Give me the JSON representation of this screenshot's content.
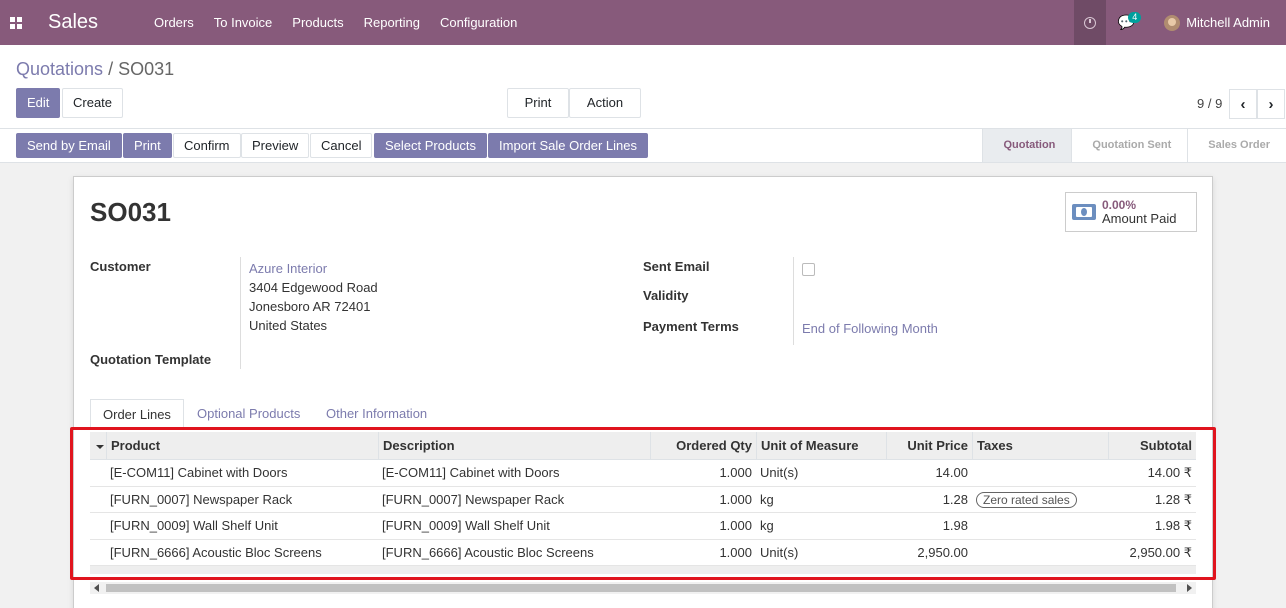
{
  "nav": {
    "app_name": "Sales",
    "menu": [
      "Orders",
      "To Invoice",
      "Products",
      "Reporting",
      "Configuration"
    ],
    "chat_count": "4",
    "user_name": "Mitchell Admin"
  },
  "control": {
    "breadcrumb_parent": "Quotations",
    "breadcrumb_sep": "/",
    "breadcrumb_current": "SO031",
    "edit_label": "Edit",
    "create_label": "Create",
    "print_label": "Print",
    "action_label": "Action",
    "pager": "9 / 9"
  },
  "statusbar": {
    "buttons": [
      "Send by Email",
      "Print",
      "Confirm",
      "Preview",
      "Cancel",
      "Select Products",
      "Import Sale Order Lines"
    ],
    "stages": [
      "Quotation",
      "Quotation Sent",
      "Sales Order"
    ],
    "active_stage": "Quotation"
  },
  "form": {
    "title": "SO031",
    "amount_paid_value": "0.00%",
    "amount_paid_label": "Amount Paid",
    "customer_label": "Customer",
    "customer_name": "Azure Interior",
    "customer_address": [
      "3404 Edgewood Road",
      "Jonesboro AR 72401",
      "United States"
    ],
    "quotation_template_label": "Quotation Template",
    "sent_email_label": "Sent Email",
    "validity_label": "Validity",
    "payment_terms_label": "Payment Terms",
    "payment_terms_value": "End of Following Month"
  },
  "tabs": [
    "Order Lines",
    "Optional Products",
    "Other Information"
  ],
  "table": {
    "headers": {
      "product": "Product",
      "description": "Description",
      "qty": "Ordered Qty",
      "uom": "Unit of Measure",
      "price": "Unit Price",
      "taxes": "Taxes",
      "subtotal": "Subtotal"
    },
    "rows": [
      {
        "product": "[E-COM11] Cabinet with Doors",
        "description": "[E-COM11] Cabinet with Doors",
        "qty": "1.000",
        "uom": "Unit(s)",
        "price": "14.00",
        "taxes": "",
        "subtotal": "14.00 ₹"
      },
      {
        "product": "[FURN_0007] Newspaper Rack",
        "description": "[FURN_0007] Newspaper Rack",
        "qty": "1.000",
        "uom": "kg",
        "price": "1.28",
        "taxes": "Zero rated sales",
        "subtotal": "1.28 ₹"
      },
      {
        "product": "[FURN_0009] Wall Shelf Unit",
        "description": "[FURN_0009] Wall Shelf Unit",
        "qty": "1.000",
        "uom": "kg",
        "price": "1.98",
        "taxes": "",
        "subtotal": "1.98 ₹"
      },
      {
        "product": "[FURN_6666] Acoustic Bloc Screens",
        "description": "[FURN_6666] Acoustic Bloc Screens",
        "qty": "1.000",
        "uom": "Unit(s)",
        "price": "2,950.00",
        "taxes": "",
        "subtotal": "2,950.00 ₹"
      }
    ]
  }
}
